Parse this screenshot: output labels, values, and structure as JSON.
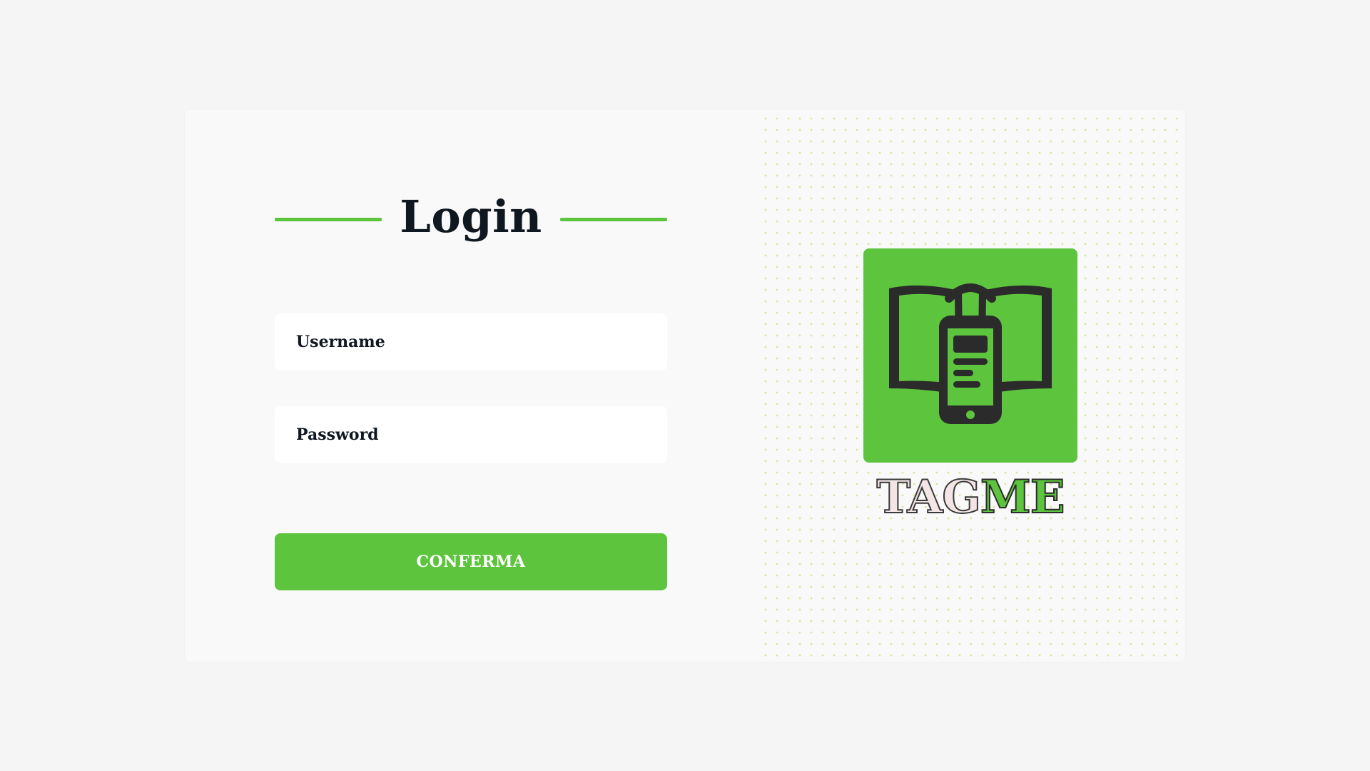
{
  "login": {
    "title": "Login",
    "username_placeholder": "Username",
    "password_placeholder": "Password",
    "confirm_label": "CONFERMA"
  },
  "brand": {
    "wordmark_part1": "TAG",
    "wordmark_part2": "ME",
    "logo_icon": "book-phone-icon"
  },
  "colors": {
    "accent": "#5dc43d",
    "text": "#0f1720",
    "background": "#f5f5f5",
    "card": "#f9f9f9",
    "icon_dark": "#2b2b2b",
    "wordmark_light": "#f3e5e5"
  }
}
